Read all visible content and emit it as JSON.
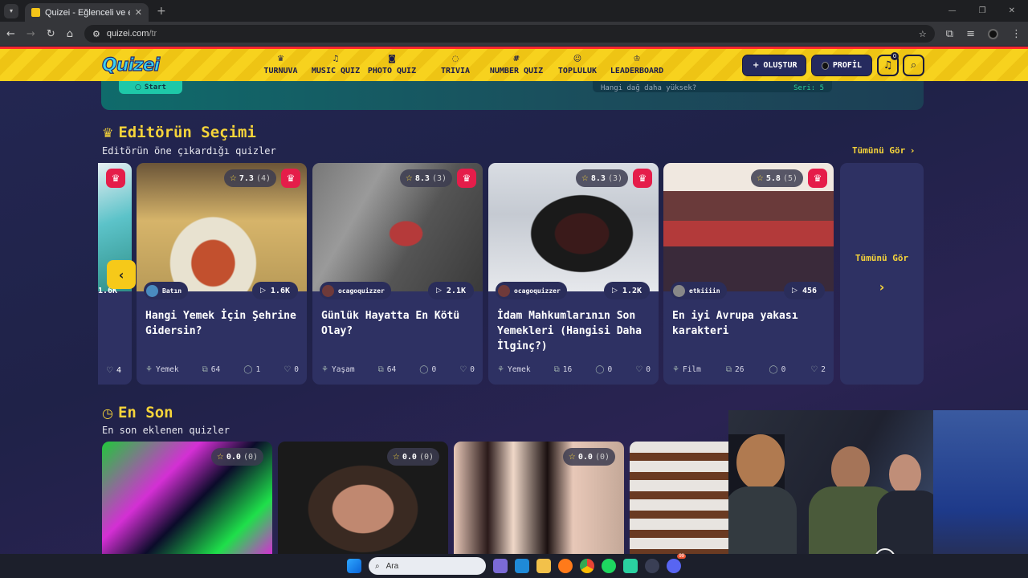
{
  "browser": {
    "tab_title": "Quizei - Eğlenceli ve etkileşimli",
    "url_host": "quizei.com",
    "url_path": "/tr"
  },
  "header": {
    "logo": "Quizei",
    "nav": [
      {
        "label": "TURNUVA",
        "icon": "trophy-icon",
        "glyph": "♛"
      },
      {
        "label": "MUSIC QUIZ",
        "icon": "music-icon",
        "glyph": "♫"
      },
      {
        "label": "PHOTO QUIZ",
        "icon": "camera-icon",
        "glyph": "◙"
      },
      {
        "label": "TRIVIA",
        "icon": "chat-icon",
        "glyph": "◌"
      },
      {
        "label": "NUMBER QUIZ",
        "icon": "hash-icon",
        "glyph": "#"
      },
      {
        "label": "TOPLULUK",
        "icon": "users-icon",
        "glyph": "☺"
      },
      {
        "label": "LEADERBOARD",
        "icon": "medal-icon",
        "glyph": "♔"
      }
    ],
    "create_label": "OLUŞTUR",
    "profile_label": "PROFİL",
    "notif_count": "0"
  },
  "banner": {
    "button_label": "Start",
    "question": "Hangi dağ daha yüksek?",
    "streak": "Seri: 5"
  },
  "editor": {
    "title": "Editörün Seçimi",
    "subtitle": "Editörün öne çıkardığı quizler",
    "see_all": "Tümünü Gör",
    "partial": {
      "plays": "1.6K",
      "likes": "4"
    },
    "cards": [
      {
        "rating": "7.3",
        "count": "(4)",
        "author": "Batın",
        "plays": "1.6K",
        "title": "Hangi Yemek İçin Şehrine Gidersin?",
        "category": "Yemek",
        "questions": "64",
        "comments": "1",
        "likes": "0"
      },
      {
        "rating": "8.3",
        "count": "(3)",
        "author": "ocagoquizzer",
        "plays": "2.1K",
        "title": "Günlük Hayatta En Kötü Olay?",
        "category": "Yaşam",
        "questions": "64",
        "comments": "0",
        "likes": "0"
      },
      {
        "rating": "8.3",
        "count": "(3)",
        "author": "ocagoquizzer",
        "plays": "1.2K",
        "title": "İdam Mahkumlarının Son Yemekleri (Hangisi Daha İlginç?)",
        "category": "Yemek",
        "questions": "16",
        "comments": "0",
        "likes": "0"
      },
      {
        "rating": "5.8",
        "count": "(5)",
        "author": "etkiiiin",
        "plays": "456",
        "title": "En iyi Avrupa yakası karakteri",
        "category": "Film",
        "questions": "26",
        "comments": "0",
        "likes": "2"
      }
    ],
    "side_label": "Tümünü Gör"
  },
  "latest": {
    "title": "En Son",
    "subtitle": "En son eklenen quizler",
    "cards": [
      {
        "rating": "0.0",
        "count": "(0)"
      },
      {
        "rating": "0.0",
        "count": "(0)"
      },
      {
        "rating": "0.0",
        "count": "(0)"
      },
      {
        "rating": "",
        "count": ""
      }
    ]
  },
  "taskbar": {
    "search_placeholder": "Ara",
    "badge": "99"
  },
  "colors": {
    "accent": "#f6d43a",
    "header_yellow": "#f7d21e",
    "crown_red": "#e51d4a",
    "card_bg": "#2e3163"
  }
}
